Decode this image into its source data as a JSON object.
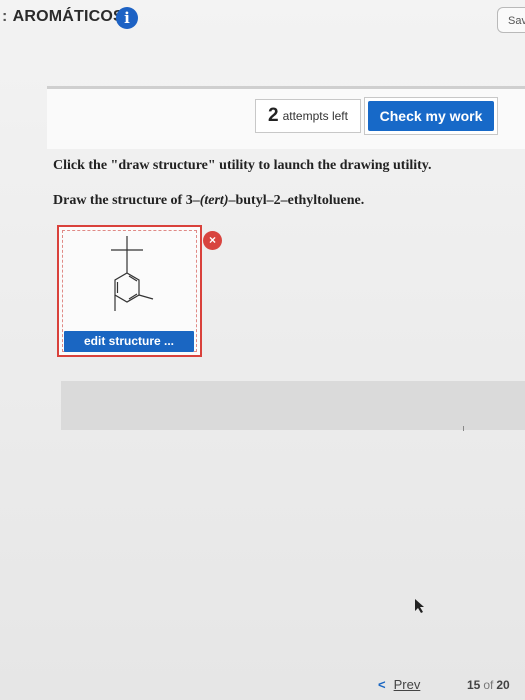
{
  "header": {
    "title_prefix": ":",
    "title": "AROMÁTICOS",
    "info_icon": "i",
    "save_label": "Sav"
  },
  "attempts": {
    "count": "2",
    "label": "attempts left"
  },
  "check_button": {
    "label": "Check my work"
  },
  "instructions": {
    "line1": "Click the \"draw structure\" utility to launch the drawing utility.",
    "line2_prefix": "Draw the structure of 3–",
    "line2_italic": "(tert)",
    "line2_suffix": "–butyl–2–ethyltoluene."
  },
  "structure": {
    "edit_label": "edit structure ...",
    "remove_icon": "×"
  },
  "footer": {
    "prev_chevron": "<",
    "prev_label": "Prev",
    "page_current": "15",
    "page_of": "of",
    "page_total": "20"
  },
  "colors": {
    "accent": "#1a66c2",
    "remove": "#d8443f",
    "box_border": "#d9413b"
  }
}
